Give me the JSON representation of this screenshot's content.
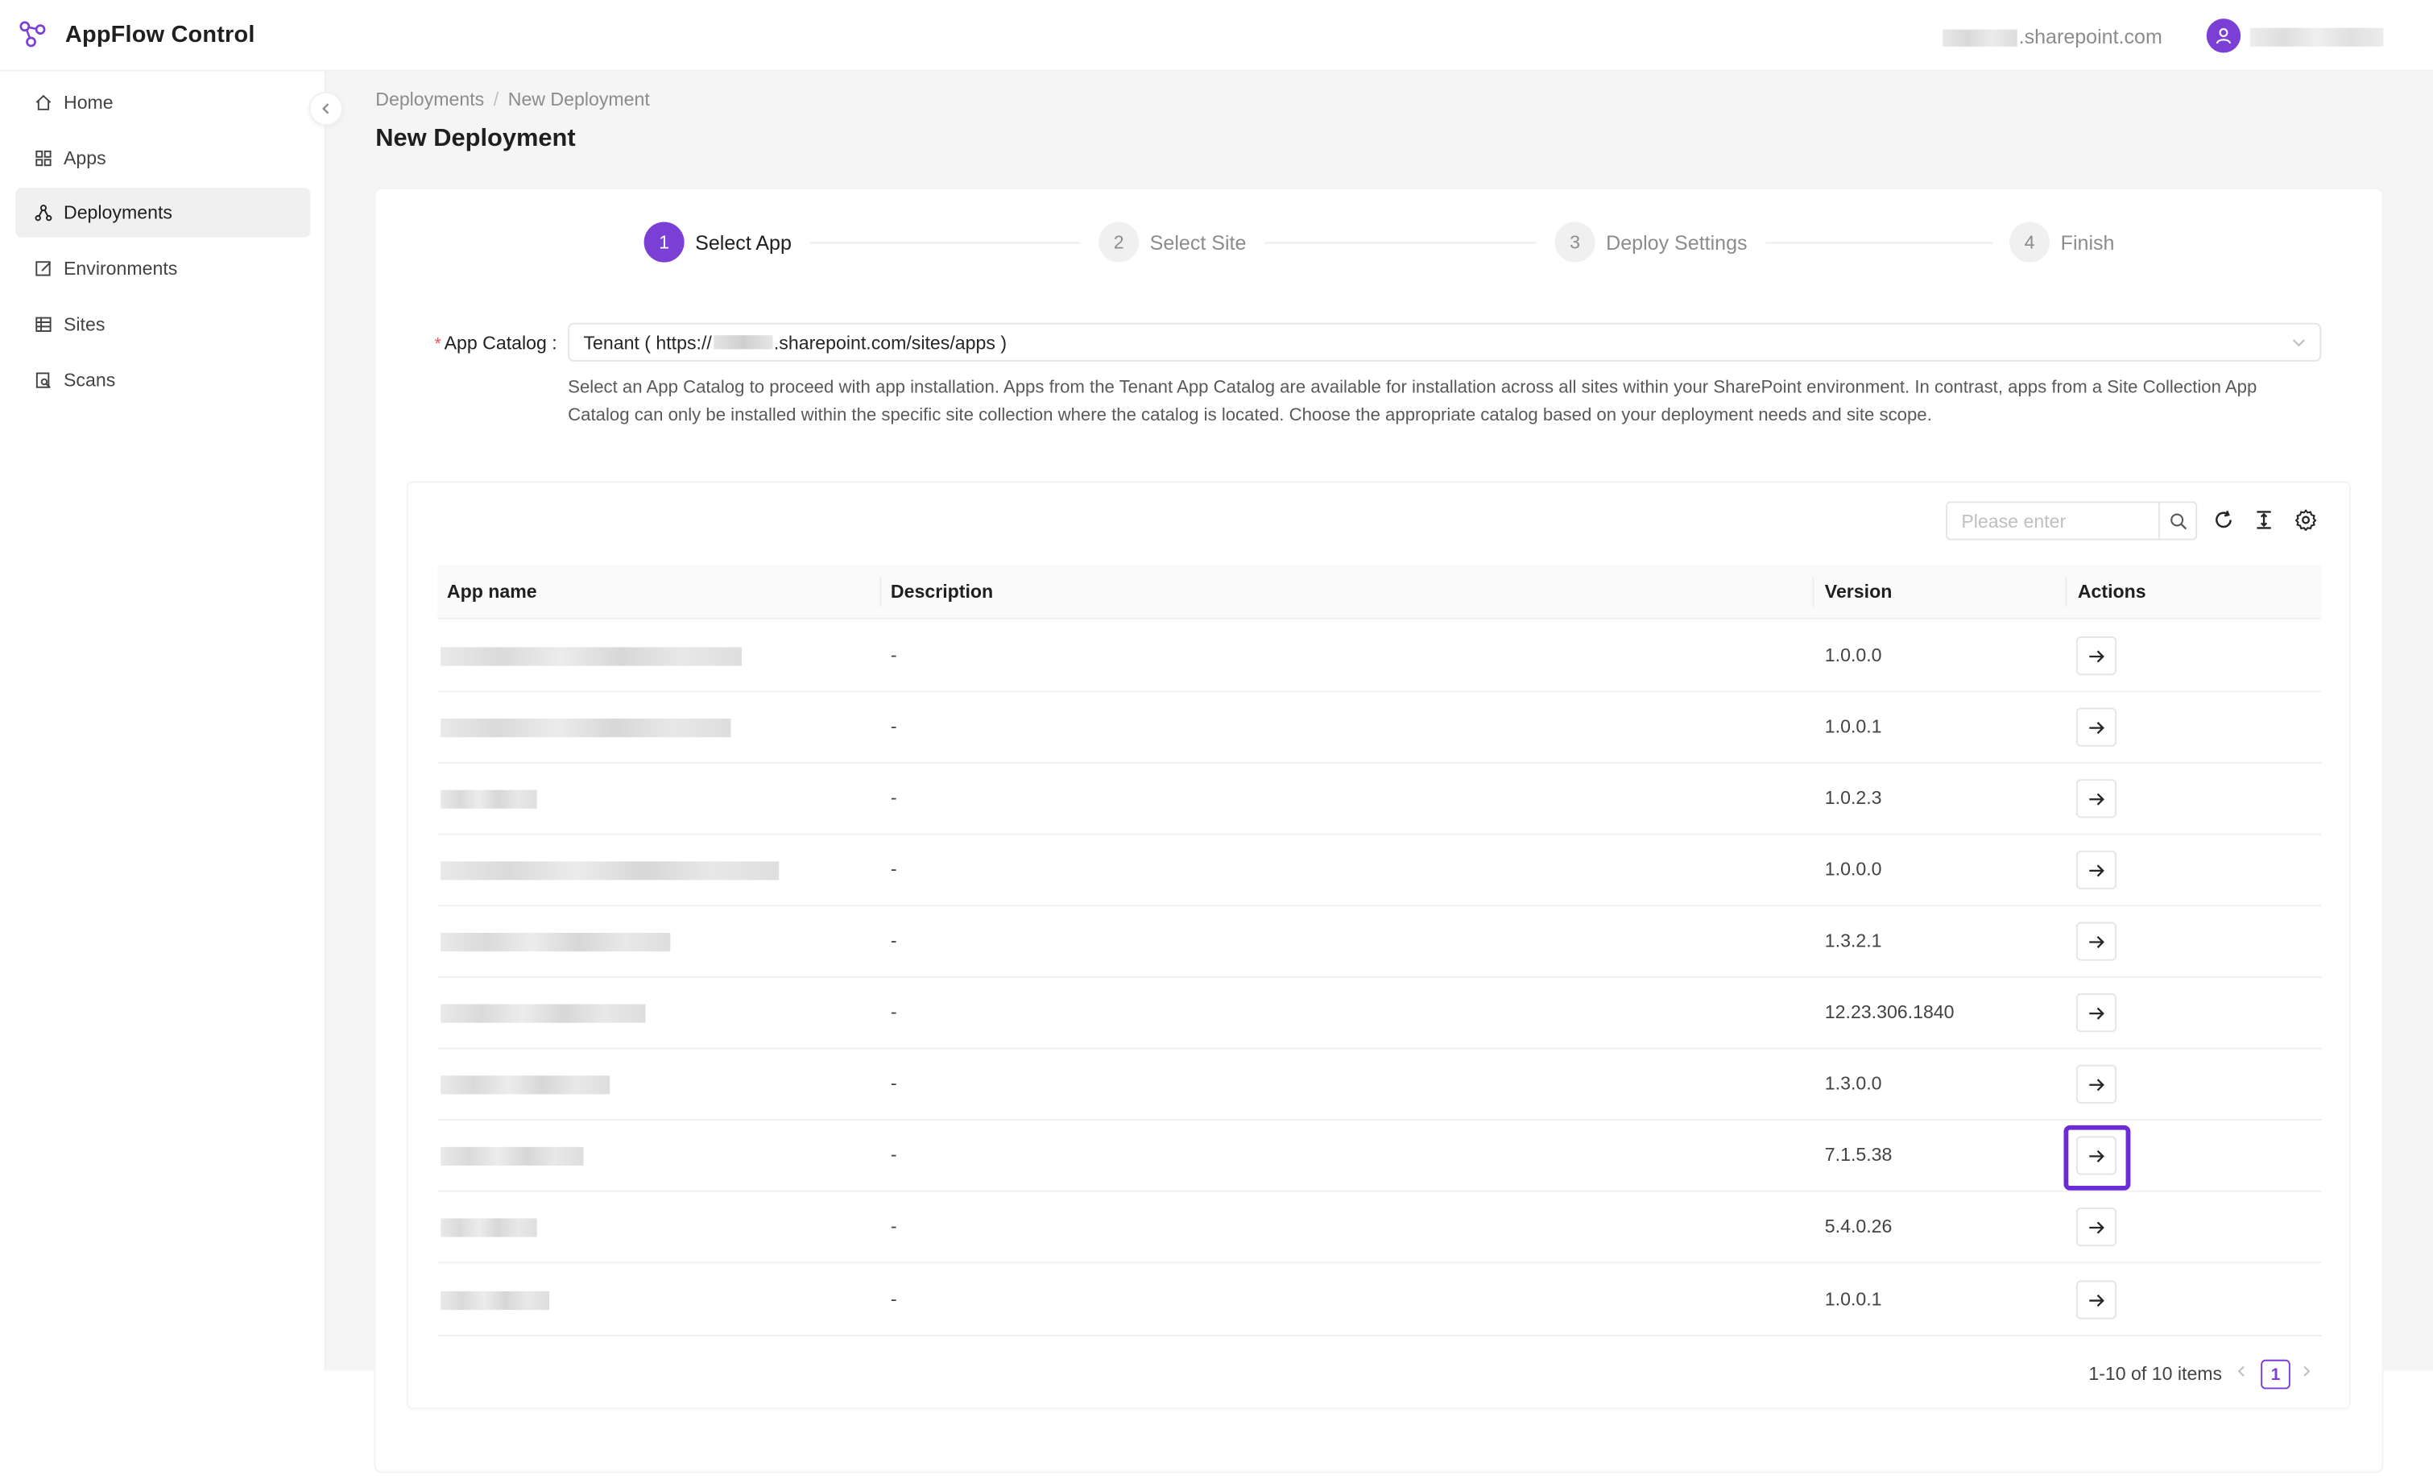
{
  "header": {
    "title": "AppFlow Control",
    "domain_suffix": ".sharepoint.com"
  },
  "sidebar": {
    "items": [
      {
        "label": "Home",
        "icon": "home-icon"
      },
      {
        "label": "Apps",
        "icon": "apps-grid-icon"
      },
      {
        "label": "Deployments",
        "icon": "deployments-icon",
        "active": true
      },
      {
        "label": "Environments",
        "icon": "edit-icon"
      },
      {
        "label": "Sites",
        "icon": "table-icon"
      },
      {
        "label": "Scans",
        "icon": "scan-icon"
      }
    ]
  },
  "breadcrumb": {
    "parent": "Deployments",
    "separator": "/",
    "current": "New Deployment"
  },
  "page_title": "New Deployment",
  "steps": [
    {
      "number": "1",
      "label": "Select App",
      "active": true
    },
    {
      "number": "2",
      "label": "Select Site"
    },
    {
      "number": "3",
      "label": "Deploy Settings"
    },
    {
      "number": "4",
      "label": "Finish"
    }
  ],
  "catalog": {
    "required_mark": "*",
    "label": "App Catalog :",
    "value_prefix": "Tenant ( https://",
    "value_suffix": ".sharepoint.com/sites/apps )",
    "help": "Select an App Catalog to proceed with app installation. Apps from the Tenant App Catalog are available for installation across all sites within your SharePoint environment. In contrast, apps from a Site Collection App Catalog can only be installed within the specific site collection where the catalog is located. Choose the appropriate catalog based on your deployment needs and site scope."
  },
  "search": {
    "placeholder": "Please enter"
  },
  "table": {
    "columns": {
      "name": "App name",
      "description": "Description",
      "version": "Version",
      "actions": "Actions"
    },
    "rows": [
      {
        "description": "-",
        "version": "1.0.0.0"
      },
      {
        "description": "-",
        "version": "1.0.0.1"
      },
      {
        "description": "-",
        "version": "1.0.2.3"
      },
      {
        "description": "-",
        "version": "1.0.0.0"
      },
      {
        "description": "-",
        "version": "1.3.2.1"
      },
      {
        "description": "-",
        "version": "12.23.306.1840"
      },
      {
        "description": "-",
        "version": "1.3.0.0"
      },
      {
        "description": "-",
        "version": "7.1.5.38"
      },
      {
        "description": "-",
        "version": "5.4.0.26"
      },
      {
        "description": "-",
        "version": "1.0.0.1"
      }
    ]
  },
  "pagination": {
    "summary": "1-10 of 10 items",
    "current_page": "1"
  },
  "colors": {
    "accent": "#7b3fd6",
    "highlight": "#6c2bd9"
  }
}
